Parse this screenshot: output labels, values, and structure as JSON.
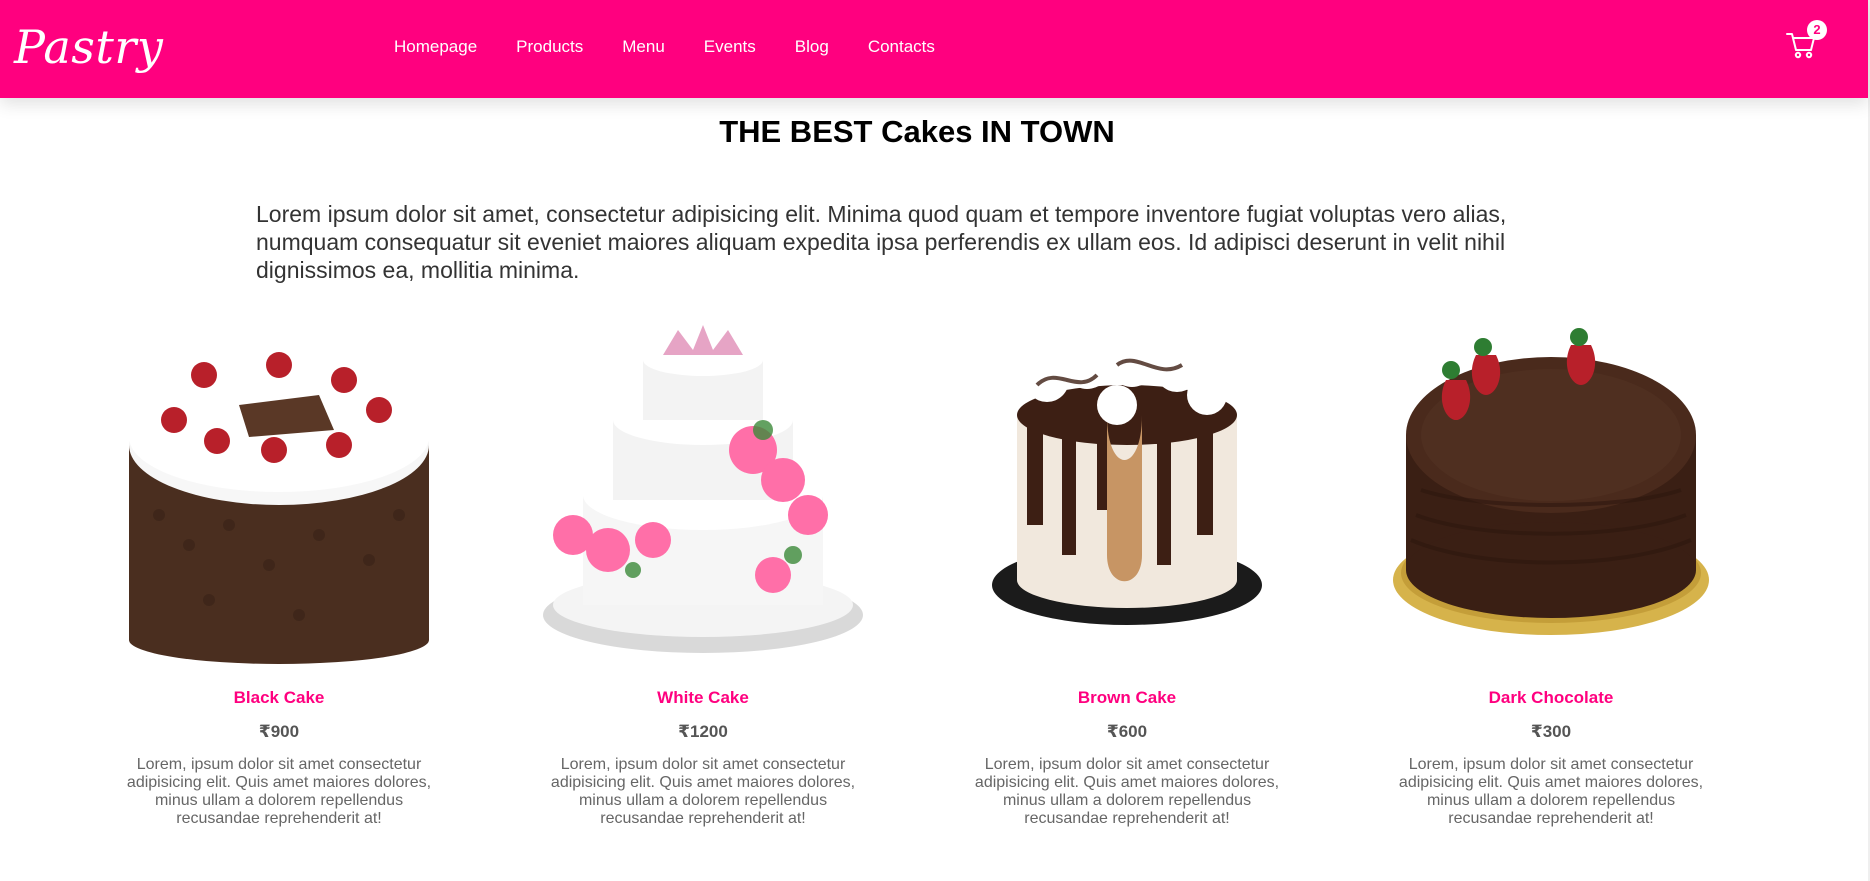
{
  "brand": {
    "logo_text": "Pastry",
    "primary_color": "#ff007f"
  },
  "nav": {
    "items": [
      {
        "label": "Homepage"
      },
      {
        "label": "Products"
      },
      {
        "label": "Menu"
      },
      {
        "label": "Events"
      },
      {
        "label": "Blog"
      },
      {
        "label": "Contacts"
      }
    ]
  },
  "cart": {
    "icon": "shopping-cart-icon",
    "count": "2"
  },
  "hero": {
    "title": "THE BEST Cakes IN TOWN",
    "intro": "Lorem ipsum dolor sit amet, consectetur adipisicing elit. Minima quod quam et tempore inventore fugiat voluptas vero alias, numquam consequatur sit eveniet maiores aliquam expedita ipsa perferendis ex ullam eos. Id adipisci deserunt in velit nihil dignissimos ea, mollitia minima."
  },
  "products": [
    {
      "name": "Black Cake",
      "price": "₹900",
      "description": "Lorem, ipsum dolor sit amet consectetur adipisicing elit. Quis amet maiores dolores, minus ullam a dolorem repellendus recusandae reprehenderit at!"
    },
    {
      "name": "White Cake",
      "price": "₹1200",
      "description": "Lorem, ipsum dolor sit amet consectetur adipisicing elit. Quis amet maiores dolores, minus ullam a dolorem repellendus recusandae reprehenderit at!"
    },
    {
      "name": "Brown Cake",
      "price": "₹600",
      "description": "Lorem, ipsum dolor sit amet consectetur adipisicing elit. Quis amet maiores dolores, minus ullam a dolorem repellendus recusandae reprehenderit at!"
    },
    {
      "name": "Dark Chocolate",
      "price": "₹300",
      "description": "Lorem, ipsum dolor sit amet consectetur adipisicing elit. Quis amet maiores dolores, minus ullam a dolorem repellendus recusandae reprehenderit at!"
    }
  ]
}
